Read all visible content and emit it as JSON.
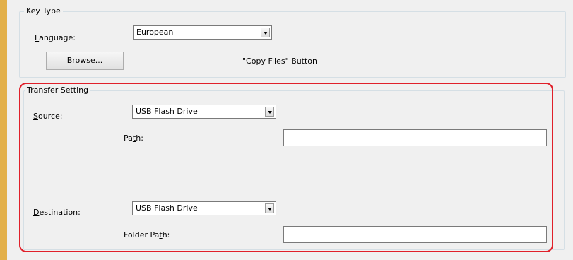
{
  "key_type": {
    "title": "Key Type",
    "language_label_ul": "L",
    "language_label_rest": "anguage:",
    "language_value": "European",
    "browse_button_ul": "B",
    "browse_button_rest": "rowse...",
    "copy_files_text": "\"Copy Files\" Button"
  },
  "transfer_setting": {
    "title": "Transfer Setting",
    "source_label_ul": "S",
    "source_label_rest": "ource:",
    "source_value": "USB Flash Drive",
    "path_label_pre": "Pa",
    "path_label_ul": "t",
    "path_label_post": "h:",
    "path_value": "",
    "destination_label_ul": "D",
    "destination_label_rest": "estination:",
    "destination_value": "USB Flash Drive",
    "folder_path_label_pre": "Folder Pa",
    "folder_path_label_ul": "t",
    "folder_path_label_post": "h:",
    "folder_path_value": ""
  },
  "colors": {
    "highlight": "#e0202a",
    "rail": "#e3b04a",
    "panel_bg": "#f0f0f0"
  }
}
